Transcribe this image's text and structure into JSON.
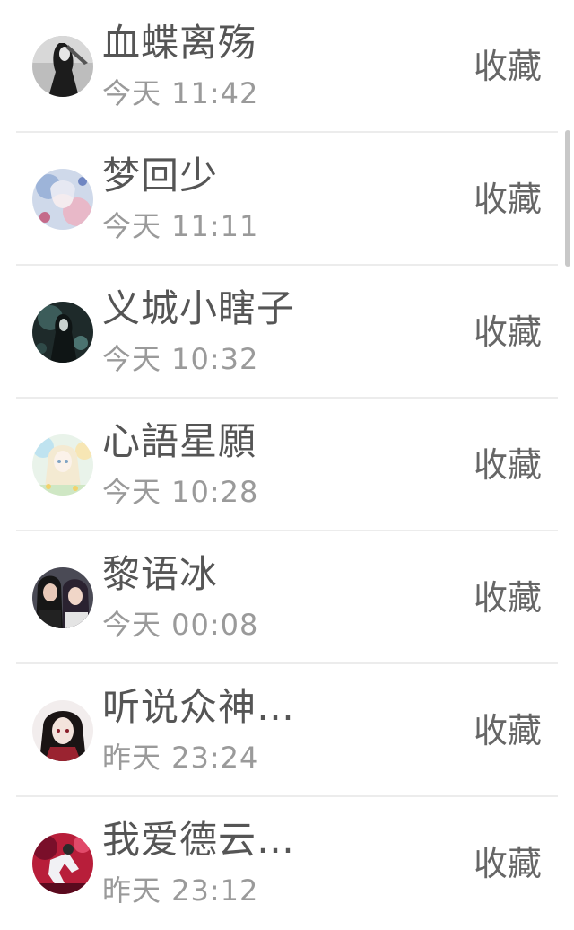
{
  "conversations": [
    {
      "name": "血蝶离殇",
      "time": "今天 11:42",
      "action": "收藏",
      "avatar": "avatar-dark-figure"
    },
    {
      "name": "梦回少",
      "time": "今天 11:11",
      "action": "收藏",
      "avatar": "avatar-anime-blue"
    },
    {
      "name": "义城小瞎子",
      "time": "今天 10:32",
      "action": "收藏",
      "avatar": "avatar-dark-teal"
    },
    {
      "name": "心語星願",
      "time": "今天 10:28",
      "action": "收藏",
      "avatar": "avatar-anime-pastel"
    },
    {
      "name": "黎语冰",
      "time": "今天 00:08",
      "action": "收藏",
      "avatar": "avatar-couple-photo"
    },
    {
      "name": "听说众神…",
      "time": "昨天 23:24",
      "action": "收藏",
      "avatar": "avatar-anime-dark-hair"
    },
    {
      "name": "我爱德云…",
      "time": "昨天 23:12",
      "action": "收藏",
      "avatar": "avatar-red-stage"
    }
  ]
}
